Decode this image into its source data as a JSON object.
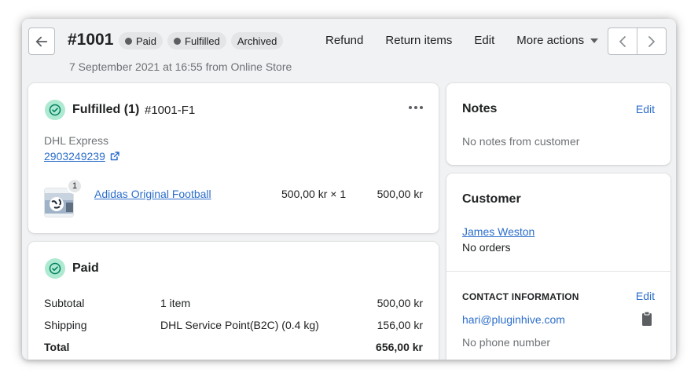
{
  "header": {
    "order_number": "#1001",
    "badges": [
      {
        "label": "Paid",
        "dot": true
      },
      {
        "label": "Fulfilled",
        "dot": true
      },
      {
        "label": "Archived",
        "dot": false
      }
    ],
    "subtitle": "7 September 2021 at 16:55 from Online Store",
    "actions": {
      "refund": "Refund",
      "return_items": "Return items",
      "edit": "Edit",
      "more_actions": "More actions"
    }
  },
  "fulfilled_card": {
    "title": "Fulfilled (1)",
    "fulfillment_id": "#1001-F1",
    "carrier": "DHL Express",
    "tracking_number": "2903249239",
    "item": {
      "name": "Adidas Original Football",
      "quantity_badge": "1",
      "unit_price": "500,00 kr × 1",
      "total": "500,00 kr"
    }
  },
  "paid_card": {
    "title": "Paid",
    "rows": [
      {
        "label": "Subtotal",
        "detail": "1 item",
        "amount": "500,00 kr"
      },
      {
        "label": "Shipping",
        "detail": "DHL Service Point(B2C) (0.4 kg)",
        "amount": "156,00 kr"
      }
    ],
    "total_label": "Total",
    "total_amount": "656,00 kr"
  },
  "notes_card": {
    "title": "Notes",
    "edit_label": "Edit",
    "body": "No notes from customer"
  },
  "customer_card": {
    "title": "Customer",
    "name": "James Weston",
    "orders": "No orders",
    "contact_heading": "CONTACT INFORMATION",
    "contact_edit_label": "Edit",
    "email": "hari@pluginhive.com",
    "phone": "No phone number"
  },
  "colors": {
    "link": "#2c6ecb",
    "success_circle": "#aee9d1",
    "success_check": "#007f5f",
    "badge_bg": "#e4e5e7",
    "page_bg": "#f1f2f3"
  },
  "icons": {
    "back": "arrow-left-icon",
    "external": "external-link-icon",
    "more": "horizontal-dots-icon",
    "check": "checkmark-circle-icon",
    "clipboard": "clipboard-icon",
    "caret": "caret-down-icon",
    "prev": "chevron-left-icon",
    "next": "chevron-right-icon"
  }
}
